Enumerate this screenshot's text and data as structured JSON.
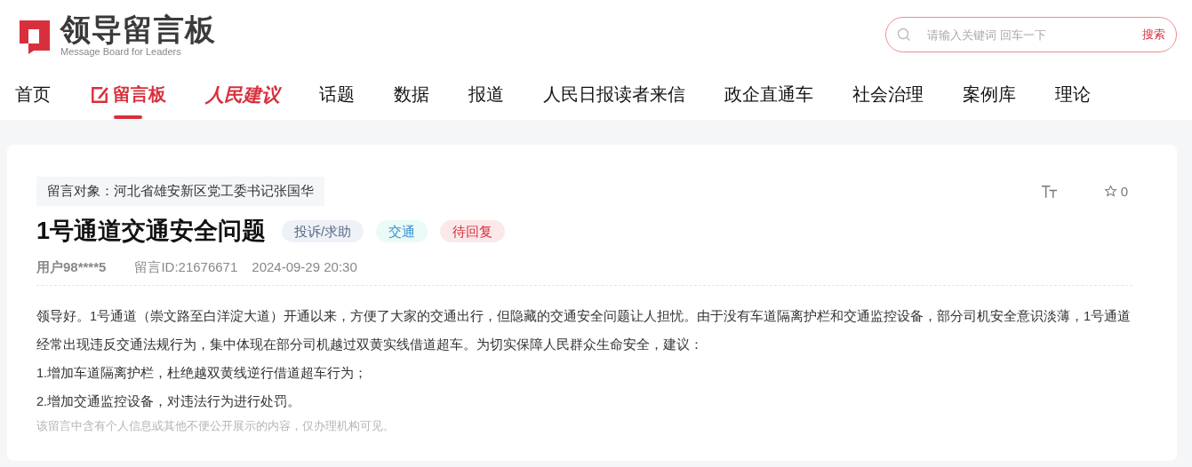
{
  "logo": {
    "title": "领导留言板",
    "subtitle": "Message Board for Leaders"
  },
  "search": {
    "placeholder": "请输入关键词 回车一下",
    "button": "搜索"
  },
  "nav": [
    {
      "label": "首页",
      "kind": "text",
      "selected": false
    },
    {
      "label": "留言板",
      "kind": "board",
      "selected": true
    },
    {
      "label": "人民建议",
      "kind": "brand",
      "selected": false
    },
    {
      "label": "话题",
      "kind": "text",
      "selected": false
    },
    {
      "label": "数据",
      "kind": "text",
      "selected": false
    },
    {
      "label": "报道",
      "kind": "text",
      "selected": false
    },
    {
      "label": "人民日报读者来信",
      "kind": "text",
      "selected": false
    },
    {
      "label": "政企直通车",
      "kind": "text",
      "selected": false
    },
    {
      "label": "社会治理",
      "kind": "text",
      "selected": false
    },
    {
      "label": "案例库",
      "kind": "text",
      "selected": false
    },
    {
      "label": "理论",
      "kind": "text",
      "selected": false
    }
  ],
  "message": {
    "target": "留言对象：河北省雄安新区党工委书记张国华",
    "title": "1号通道交通安全问题",
    "tags": [
      {
        "label": "投诉/求助",
        "color": "#eef2f8"
      },
      {
        "label": "交通",
        "color": "#eafaf7"
      },
      {
        "label": "待回复",
        "color": "#fbe9ea"
      }
    ],
    "stars": "0",
    "user": "用户98****5",
    "id": "留言ID:21676671",
    "time": "2024-09-29 20:30",
    "body": [
      "领导好。1号通道（崇文路至白洋淀大道）开通以来，方便了大家的交通出行，但隐藏的交通安全问题让人担忧。由于没有车道隔离护栏和交通监控设备，部分司机安全意识淡薄，1号通道经常出现违反交通法规行为，集中体现在部分司机越过双黄实线借道超车。为切实保障人民群众生命安全，建议：",
      "1.增加车道隔离护栏，杜绝越双黄线逆行借道超车行为；",
      "2.增加交通监控设备，对违法行为进行处罚。"
    ],
    "notice": "该留言中含有个人信息或其他不便公开展示的内容，仅办理机构可见。"
  }
}
